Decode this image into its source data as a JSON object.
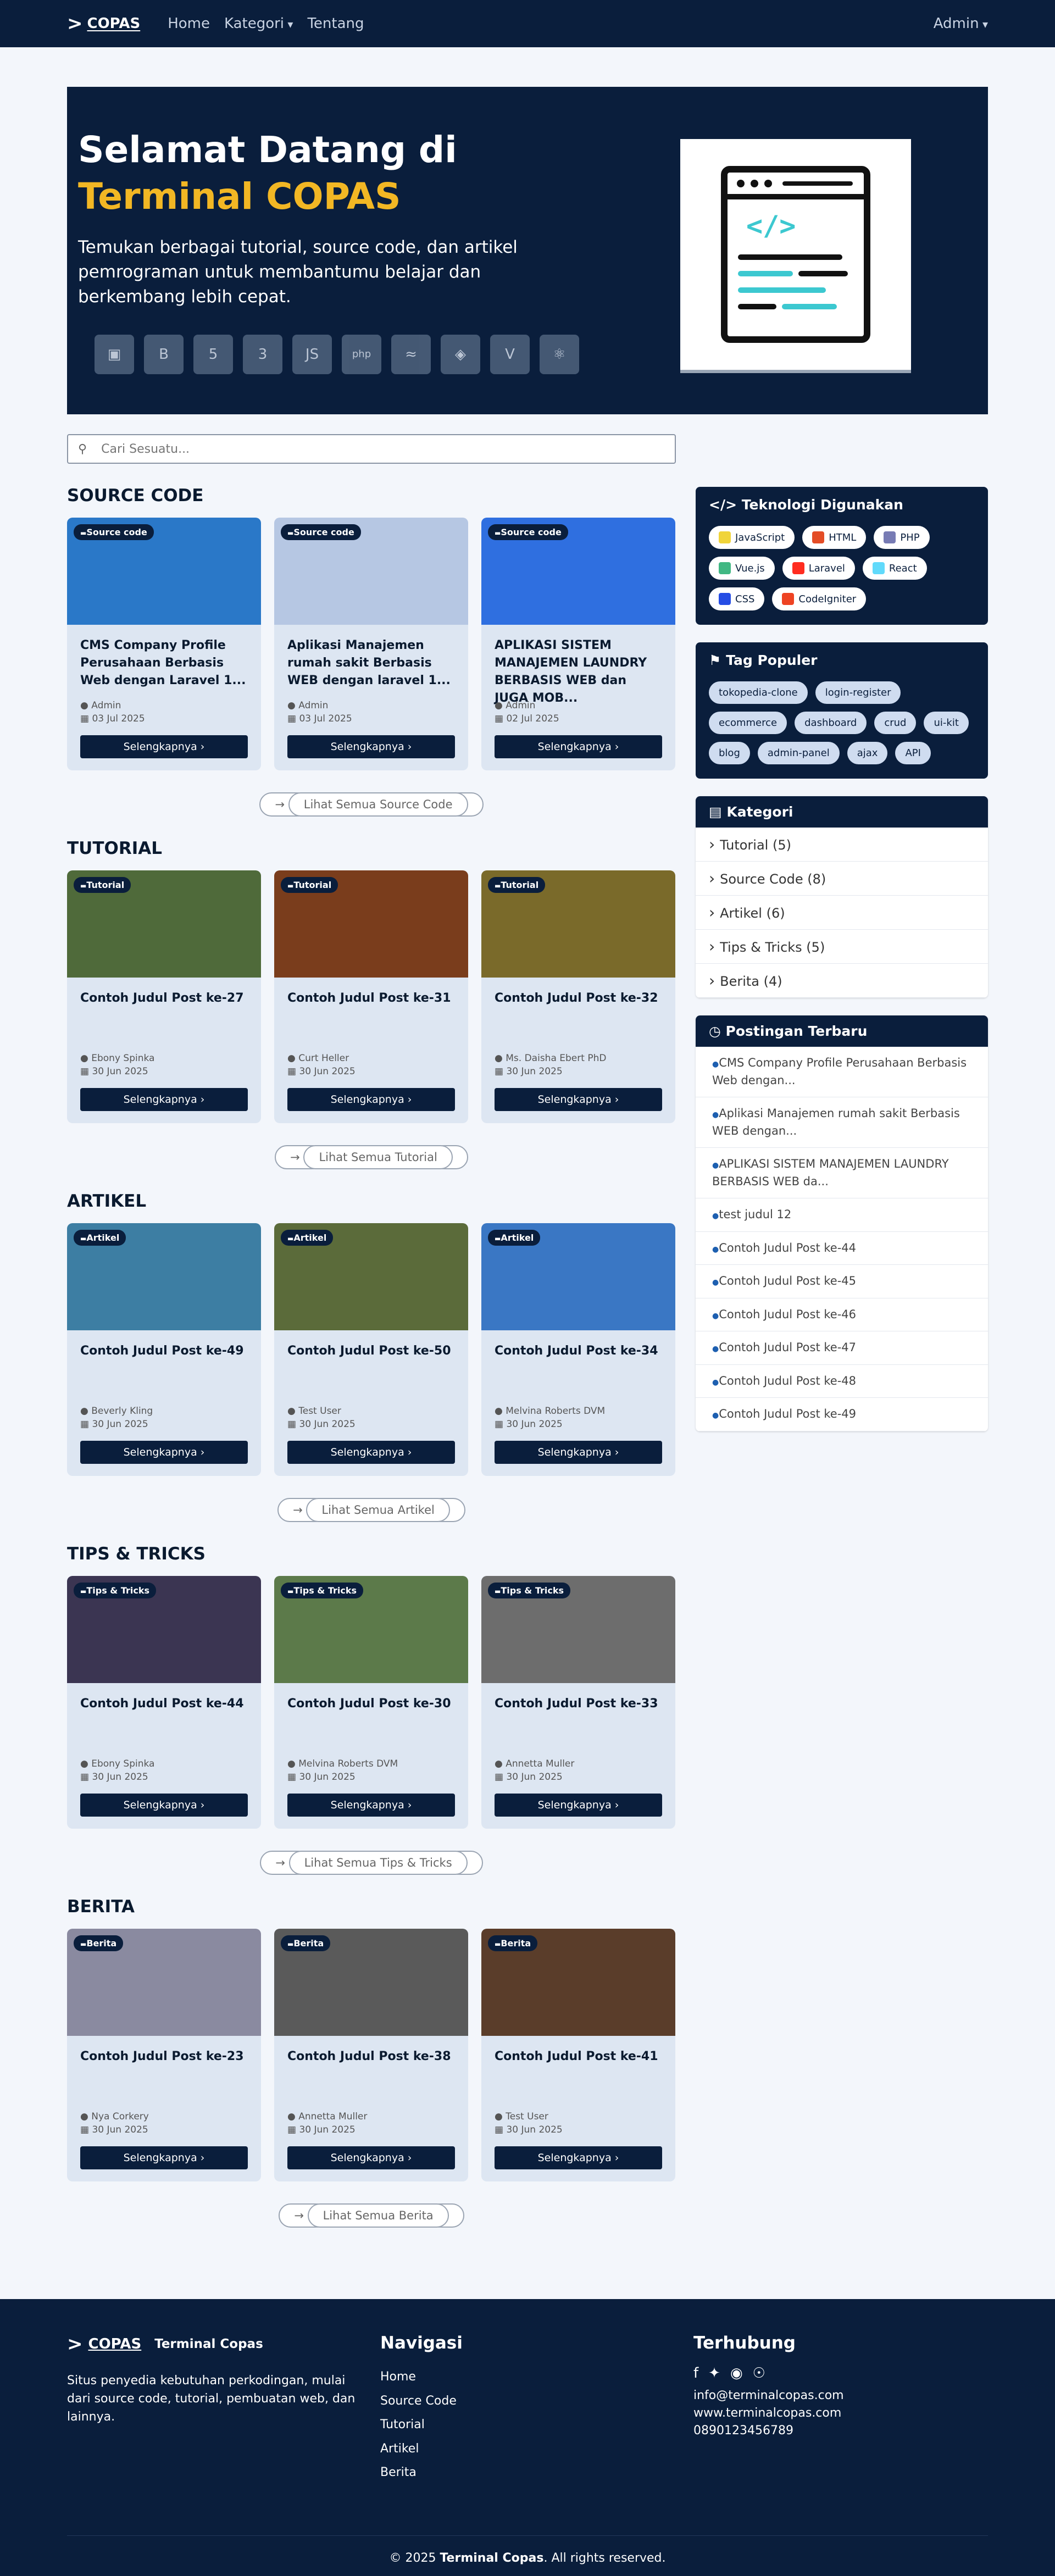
{
  "navbar": {
    "brand": "COPAS",
    "links": [
      "Home",
      "Kategori",
      "Tentang"
    ],
    "user": "Admin"
  },
  "hero": {
    "title_line1": "Selamat Datang di",
    "title_line2": "Terminal COPAS",
    "subtitle": "Temukan berbagai tutorial, source code, dan artikel pemrograman untuk membantumu belajar dan berkembang lebih cepat.",
    "tech_icons": [
      "laravel-icon",
      "bootstrap-icon",
      "html5-icon",
      "css3-icon",
      "js-icon",
      "php-icon",
      "mysql-icon",
      "python-icon",
      "vue-icon",
      "react-icon"
    ]
  },
  "search": {
    "placeholder": "Cari Sesuatu..."
  },
  "sections": [
    {
      "title": "SOURCE CODE",
      "badge": "Source code",
      "see_all": "Lihat Semua Source Code",
      "cards": [
        {
          "title": "CMS Company Profile Perusahaan Berbasis Web dengan Laravel 1...",
          "author": "Admin",
          "date": "03 Jul 2025",
          "color": "#2a78c8"
        },
        {
          "title": "Aplikasi Manajemen rumah sakit Berbasis WEB dengan laravel 1...",
          "author": "Admin",
          "date": "03 Jul 2025",
          "color": "#b6c7e3"
        },
        {
          "title": "APLIKASI SISTEM MANAJEMEN LAUNDRY BERBASIS WEB dan JUGA MOB...",
          "author": "Admin",
          "date": "02 Jul 2025",
          "color": "#2f6fe0"
        }
      ]
    },
    {
      "title": "TUTORIAL",
      "badge": "Tutorial",
      "see_all": "Lihat Semua Tutorial",
      "cards": [
        {
          "title": "Contoh Judul Post ke-27",
          "author": "Ebony Spinka",
          "date": "30 Jun 2025",
          "color": "#4f6a3a"
        },
        {
          "title": "Contoh Judul Post ke-31",
          "author": "Curt Heller",
          "date": "30 Jun 2025",
          "color": "#7a3d1c"
        },
        {
          "title": "Contoh Judul Post ke-32",
          "author": "Ms. Daisha Ebert PhD",
          "date": "30 Jun 2025",
          "color": "#7a6a2a"
        }
      ]
    },
    {
      "title": "ARTIKEL",
      "badge": "Artikel",
      "see_all": "Lihat Semua Artikel",
      "cards": [
        {
          "title": "Contoh Judul Post ke-49",
          "author": "Beverly Kling",
          "date": "30 Jun 2025",
          "color": "#3d7ea3"
        },
        {
          "title": "Contoh Judul Post ke-50",
          "author": "Test User",
          "date": "30 Jun 2025",
          "color": "#5b6b3a"
        },
        {
          "title": "Contoh Judul Post ke-34",
          "author": "Melvina Roberts DVM",
          "date": "30 Jun 2025",
          "color": "#3a77c4"
        }
      ]
    },
    {
      "title": "TIPS & TRICKS",
      "badge": "Tips & Tricks",
      "see_all": "Lihat Semua Tips & Tricks",
      "cards": [
        {
          "title": "Contoh Judul Post ke-44",
          "author": "Ebony Spinka",
          "date": "30 Jun 2025",
          "color": "#3b3552"
        },
        {
          "title": "Contoh Judul Post ke-30",
          "author": "Melvina Roberts DVM",
          "date": "30 Jun 2025",
          "color": "#5c7a4a"
        },
        {
          "title": "Contoh Judul Post ke-33",
          "author": "Annetta Muller",
          "date": "30 Jun 2025",
          "color": "#6d6d6d"
        }
      ]
    },
    {
      "title": "BERITA",
      "badge": "Berita",
      "see_all": "Lihat Semua Berita",
      "cards": [
        {
          "title": "Contoh Judul Post ke-23",
          "author": "Nya Corkery",
          "date": "30 Jun 2025",
          "color": "#8a8aa0"
        },
        {
          "title": "Contoh Judul Post ke-38",
          "author": "Annetta Muller",
          "date": "30 Jun 2025",
          "color": "#5a5a5a"
        },
        {
          "title": "Contoh Judul Post ke-41",
          "author": "Test User",
          "date": "30 Jun 2025",
          "color": "#5a3d2a"
        }
      ]
    }
  ],
  "card_button": "Selengkapnya",
  "sidebar": {
    "tech_title": "Teknologi Digunakan",
    "tech": [
      {
        "name": "JavaScript",
        "color": "#f0d43a"
      },
      {
        "name": "HTML",
        "color": "#e44d26"
      },
      {
        "name": "PHP",
        "color": "#777bb4"
      },
      {
        "name": "Vue.js",
        "color": "#41b883"
      },
      {
        "name": "Laravel",
        "color": "#ff2d20"
      },
      {
        "name": "React",
        "color": "#61dafb"
      },
      {
        "name": "CSS",
        "color": "#264de4"
      },
      {
        "name": "CodeIgniter",
        "color": "#ee4323"
      }
    ],
    "tags_title": "Tag Populer",
    "tags": [
      "tokopedia-clone",
      "login-register",
      "ecommerce",
      "dashboard",
      "crud",
      "ui-kit",
      "blog",
      "admin-panel",
      "ajax",
      "API"
    ],
    "categories_title": "Kategori",
    "categories": [
      "Tutorial (5)",
      "Source Code (8)",
      "Artikel (6)",
      "Tips & Tricks (5)",
      "Berita (4)"
    ],
    "recent_title": "Postingan Terbaru",
    "recent": [
      "CMS Company Profile Perusahaan Berbasis Web dengan...",
      "Aplikasi Manajemen rumah sakit Berbasis WEB dengan...",
      "APLIKASI SISTEM MANAJEMEN LAUNDRY BERBASIS WEB da...",
      "test judul 12",
      "Contoh Judul Post ke-44",
      "Contoh Judul Post ke-45",
      "Contoh Judul Post ke-46",
      "Contoh Judul Post ke-47",
      "Contoh Judul Post ke-48",
      "Contoh Judul Post ke-49"
    ]
  },
  "footer": {
    "brand": "COPAS",
    "site_name": "Terminal Copas",
    "desc": "Situs penyedia kebutuhan perkodingan, mulai dari source code, tutorial, pembuatan web, dan lainnya.",
    "nav_title": "Navigasi",
    "nav_links": [
      "Home",
      "Source Code",
      "Tutorial",
      "Artikel",
      "Berita"
    ],
    "contact_title": "Terhubung",
    "email": "info@terminalcopas.com",
    "website": "www.terminalcopas.com",
    "phone": "0890123456789",
    "copyright_prefix": "© 2025 ",
    "copyright_brand": "Terminal Copas",
    "copyright_suffix": ". All rights reserved."
  }
}
